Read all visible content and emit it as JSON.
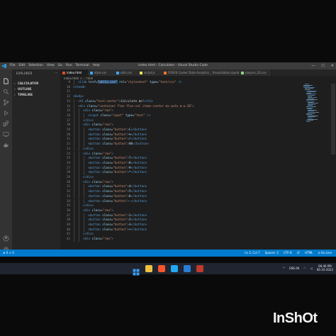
{
  "titlebar": {
    "menu": [
      "File",
      "Edit",
      "Selection",
      "View",
      "Go",
      "Run",
      "Terminal",
      "Help"
    ],
    "title": "index.html - Calculator - Visual Studio Code"
  },
  "sidebar": {
    "header": "EXPLORER",
    "sections": [
      "CALCULATOR",
      "OUTLINE",
      "TIMELINE"
    ]
  },
  "tabs": [
    {
      "label": "index.html",
      "icon_color": "#e44d26",
      "active": true
    },
    {
      "label": "style.css",
      "icon_color": "#42a5f5",
      "active": false
    },
    {
      "label": "utils.css",
      "icon_color": "#42a5f5",
      "active": false
    },
    {
      "label": "script.js",
      "icon_color": "#f1e05a",
      "active": false
    },
    {
      "label": "FIFA20 Career Data Analytics _ Visualization.ipynb",
      "icon_color": "#f37626",
      "active": false
    },
    {
      "label": "players_20.csv",
      "icon_color": "#89d185",
      "active": false
    }
  ],
  "breadcrumb": "index.html > ⬚ html",
  "code": [
    {
      "n": "9",
      "indent": 1,
      "html": "<span class='tag'>&lt;link</span> <span class='attr'>href</span><span class='txt'>=</span><span class='str sel'>\"utils.css\"</span> <span class='attr'>rel</span><span class='txt'>=</span><span class='str'>\"stylesheet\"</span> <span class='attr'>type</span><span class='txt'>=</span><span class='str'>\"text/css\"</span> <span class='tag'>/&gt;</span>"
    },
    {
      "n": "10",
      "indent": 0,
      "html": "<span class='tag'>&lt;/head&gt;</span>"
    },
    {
      "n": "11",
      "indent": 0,
      "html": ""
    },
    {
      "n": "12",
      "indent": 0,
      "html": "<span class='tag'>&lt;body&gt;</span>"
    },
    {
      "n": "13",
      "indent": 1,
      "html": "<span class='tag'>&lt;h1</span> <span class='attr'>class</span><span class='txt'>=</span><span class='str'>\"text-center\"</span><span class='tag'>&gt;</span><span class='txt'>Calculate me!</span><span class='tag'>&lt;/h1&gt;</span>"
    },
    {
      "n": "14",
      "indent": 1,
      "html": "<span class='tag'>&lt;div</span> <span class='attr'>class</span><span class='txt'>=</span><span class='str'>\"container flex flex-col items-center mx-auto m-w-20\"</span><span class='tag'>&gt;</span>"
    },
    {
      "n": "15",
      "indent": 2,
      "html": "<span class='tag'>&lt;div</span> <span class='attr'>class</span><span class='txt'>=</span><span class='str'>\"row\"</span><span class='tag'>&gt;</span>"
    },
    {
      "n": "16",
      "indent": 3,
      "html": "<span class='tag'>&lt;input</span> <span class='attr'>class</span><span class='txt'>=</span><span class='str'>\"input\"</span> <span class='attr'>type</span><span class='txt'>=</span><span class='str'>\"text\"</span> <span class='tag'>/&gt;</span>"
    },
    {
      "n": "17",
      "indent": 2,
      "html": "<span class='tag'>&lt;/div&gt;</span>"
    },
    {
      "n": "18",
      "indent": 2,
      "html": "<span class='tag'>&lt;div</span> <span class='attr'>class</span><span class='txt'>=</span><span class='str'>\"row\"</span><span class='tag'>&gt;</span>"
    },
    {
      "n": "19",
      "indent": 3,
      "html": "<span class='tag'>&lt;button</span> <span class='attr'>class</span><span class='txt'>=</span><span class='str'>\"button\"</span><span class='tag'>&gt;</span><span class='txt'>C</span><span class='tag'>&lt;/button&gt;</span>"
    },
    {
      "n": "20",
      "indent": 3,
      "html": "<span class='tag'>&lt;button</span> <span class='attr'>class</span><span class='txt'>=</span><span class='str'>\"button\"</span><span class='tag'>&gt;</span><span class='txt'>%</span><span class='tag'>&lt;/button&gt;</span>"
    },
    {
      "n": "21",
      "indent": 3,
      "html": "<span class='tag'>&lt;button</span> <span class='attr'>class</span><span class='txt'>=</span><span class='str'>\"button\"</span><span class='tag'>&gt;</span><span class='txt'>/</span><span class='tag'>&lt;/button&gt;</span>"
    },
    {
      "n": "22",
      "indent": 3,
      "html": "<span class='tag'>&lt;button</span> <span class='attr'>class</span><span class='txt'>=</span><span class='str'>\"button\"</span><span class='tag'>&gt;</span><span class='txt'>00</span><span class='tag'>&lt;/button&gt;</span>"
    },
    {
      "n": "23",
      "indent": 2,
      "html": "<span class='tag'>&lt;/div&gt;</span>"
    },
    {
      "n": "24",
      "indent": 2,
      "html": "<span class='tag'>&lt;div</span> <span class='attr'>class</span><span class='txt'>=</span><span class='str'>\"row\"</span><span class='tag'>&gt;</span>"
    },
    {
      "n": "25",
      "indent": 3,
      "html": "<span class='tag'>&lt;button</span> <span class='attr'>class</span><span class='txt'>=</span><span class='str'>\"button\"</span><span class='tag'>&gt;</span><span class='txt'>7</span><span class='tag'>&lt;/button&gt;</span>"
    },
    {
      "n": "26",
      "indent": 3,
      "html": "<span class='tag'>&lt;button</span> <span class='attr'>class</span><span class='txt'>=</span><span class='str'>\"button\"</span><span class='tag'>&gt;</span><span class='txt'>8</span><span class='tag'>&lt;/button&gt;</span>"
    },
    {
      "n": "27",
      "indent": 3,
      "html": "<span class='tag'>&lt;button</span> <span class='attr'>class</span><span class='txt'>=</span><span class='str'>\"button\"</span><span class='tag'>&gt;</span><span class='txt'>9</span><span class='tag'>&lt;/button&gt;</span>"
    },
    {
      "n": "28",
      "indent": 3,
      "html": "<span class='tag'>&lt;button</span> <span class='attr'>class</span><span class='txt'>=</span><span class='str'>\"button\"</span><span class='tag'>&gt;</span><span class='txt'>*</span><span class='tag'>&lt;/button&gt;</span>"
    },
    {
      "n": "29",
      "indent": 2,
      "html": "<span class='tag'>&lt;/div&gt;</span>"
    },
    {
      "n": "30",
      "indent": 2,
      "html": "<span class='tag'>&lt;div</span> <span class='attr'>class</span><span class='txt'>=</span><span class='str'>\"row\"</span><span class='tag'>&gt;</span>"
    },
    {
      "n": "31",
      "indent": 3,
      "html": "<span class='tag'>&lt;button</span> <span class='attr'>class</span><span class='txt'>=</span><span class='str'>\"button\"</span><span class='tag'>&gt;</span><span class='txt'>4</span><span class='tag'>&lt;/button&gt;</span>"
    },
    {
      "n": "32",
      "indent": 3,
      "html": "<span class='tag'>&lt;button</span> <span class='attr'>class</span><span class='txt'>=</span><span class='str'>\"button\"</span><span class='tag'>&gt;</span><span class='txt'>5</span><span class='tag'>&lt;/button&gt;</span>"
    },
    {
      "n": "33",
      "indent": 3,
      "html": "<span class='tag'>&lt;button</span> <span class='attr'>class</span><span class='txt'>=</span><span class='str'>\"button\"</span><span class='tag'>&gt;</span><span class='txt'>6</span><span class='tag'>&lt;/button&gt;</span>"
    },
    {
      "n": "34",
      "indent": 3,
      "html": "<span class='tag'>&lt;button</span> <span class='attr'>class</span><span class='txt'>=</span><span class='str'>\"button\"</span><span class='tag'>&gt;</span><span class='txt'>-</span><span class='tag'>&lt;/button&gt;</span>"
    },
    {
      "n": "35",
      "indent": 2,
      "html": "<span class='tag'>&lt;/div&gt;</span>"
    },
    {
      "n": "36",
      "indent": 2,
      "html": "<span class='tag'>&lt;div</span> <span class='attr'>class</span><span class='txt'>=</span><span class='str'>\"row\"</span><span class='tag'>&gt;</span>"
    },
    {
      "n": "37",
      "indent": 3,
      "html": "<span class='tag'>&lt;button</span> <span class='attr'>class</span><span class='txt'>=</span><span class='str'>\"button\"</span><span class='tag'>&gt;</span><span class='txt'>1</span><span class='tag'>&lt;/button&gt;</span>"
    },
    {
      "n": "38",
      "indent": 3,
      "html": "<span class='tag'>&lt;button</span> <span class='attr'>class</span><span class='txt'>=</span><span class='str'>\"button\"</span><span class='tag'>&gt;</span><span class='txt'>2</span><span class='tag'>&lt;/button&gt;</span>"
    },
    {
      "n": "39",
      "indent": 3,
      "html": "<span class='tag'>&lt;button</span> <span class='attr'>class</span><span class='txt'>=</span><span class='str'>\"button\"</span><span class='tag'>&gt;</span><span class='txt'>3</span><span class='tag'>&lt;/button&gt;</span>"
    },
    {
      "n": "40",
      "indent": 3,
      "html": "<span class='tag'>&lt;button</span> <span class='attr'>class</span><span class='txt'>=</span><span class='str'>\"button\"</span><span class='tag'>&gt;</span><span class='txt'>+</span><span class='tag'>&lt;/button&gt;</span>"
    },
    {
      "n": "41",
      "indent": 2,
      "html": "<span class='tag'>&lt;/div&gt;</span>"
    },
    {
      "n": "42",
      "indent": 2,
      "html": "<span class='tag'>&lt;div</span> <span class='attr'>class</span><span class='txt'>=</span><span class='str'>\"row\"</span><span class='tag'>&gt;</span>"
    }
  ],
  "statusbar": {
    "left": "⊗ 0 ⚠ 0",
    "right": [
      "Ln 2, Col 7",
      "Spaces: 2",
      "UTF-8",
      "LF",
      "HTML",
      "⊘ Go Live"
    ]
  },
  "taskbar": {
    "icons": [
      {
        "name": "windows-start-icon",
        "color": "#3a9cf0"
      },
      {
        "name": "file-explorer-icon",
        "color": "#f0c040"
      },
      {
        "name": "brave-browser-icon",
        "color": "#fb542b"
      },
      {
        "name": "vscode-icon",
        "color": "#23a9f2"
      },
      {
        "name": "word-icon",
        "color": "#2b7cd3"
      },
      {
        "name": "python-icon",
        "color": "#c0392b"
      }
    ],
    "lang": "ENG IN",
    "time": "06:46 PM",
    "date": "06-10-2022"
  },
  "watermark": "InShOt"
}
